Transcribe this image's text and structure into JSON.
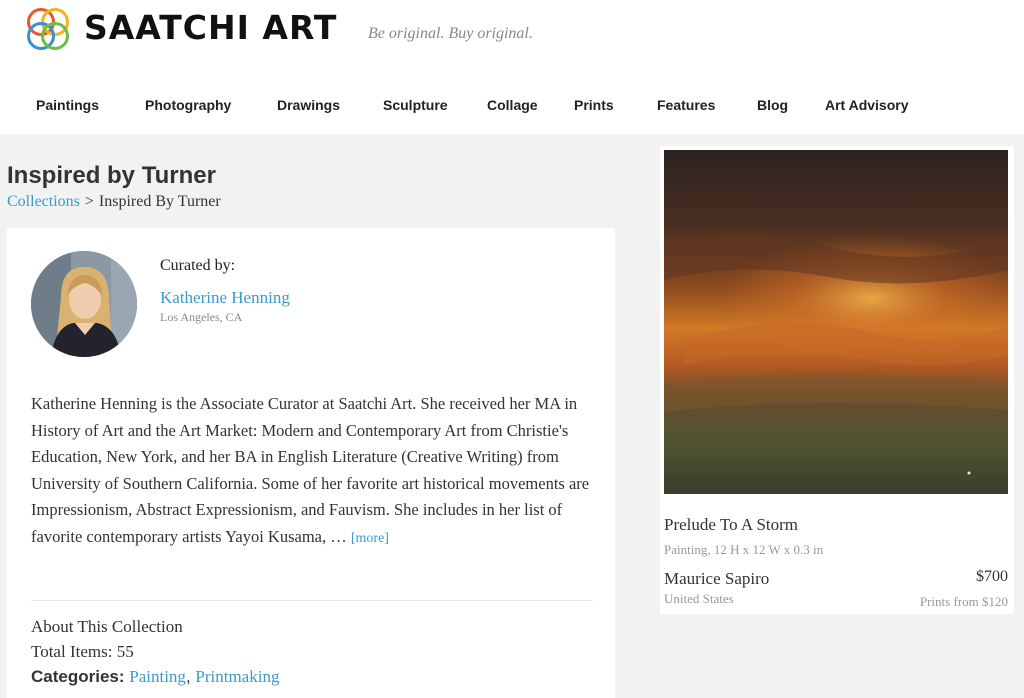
{
  "header": {
    "brand": "SAATCHI ART",
    "tagline": "Be original.  Buy original."
  },
  "nav": {
    "items": [
      {
        "label": "Paintings"
      },
      {
        "label": "Photography"
      },
      {
        "label": "Drawings"
      },
      {
        "label": "Sculpture"
      },
      {
        "label": "Collage"
      },
      {
        "label": "Prints"
      },
      {
        "label": "Features"
      },
      {
        "label": "Blog"
      },
      {
        "label": "Art Advisory"
      }
    ]
  },
  "page": {
    "title": "Inspired by Turner",
    "breadcrumb": {
      "root": "Collections",
      "separator": ">",
      "current": "Inspired By Turner"
    }
  },
  "curator": {
    "label": "Curated by:",
    "name": "Katherine Henning",
    "location": "Los Angeles, CA",
    "bio": "Katherine Henning is the Associate Curator at Saatchi Art. She received her MA in History of Art and the Art Market: Modern and Contemporary Art from Christie's Education, New York, and her BA in English Literature (Creative Writing) from University of Southern California. Some of her favorite art historical movements are Impressionism, Abstract Expressionism, and Fauvism. She includes in her list of favorite contemporary artists Yayoi Kusama, … ",
    "more": "[more]"
  },
  "collection": {
    "about": "About This Collection",
    "total_label": "Total Items:",
    "total_value": "55",
    "categories_label": "Categories:",
    "categories": [
      "Painting",
      "Printmaking"
    ],
    "category_separator": ", "
  },
  "artwork": {
    "title": "Prelude To A Storm",
    "meta": "Painting, 12 H x 12 W x 0.3 in",
    "artist": "Maurice Sapiro",
    "country": "United States",
    "price": "$700",
    "prints": "Prints from $120"
  },
  "colors": {
    "link": "#3a9bc8",
    "background": "#f2f2f2"
  }
}
